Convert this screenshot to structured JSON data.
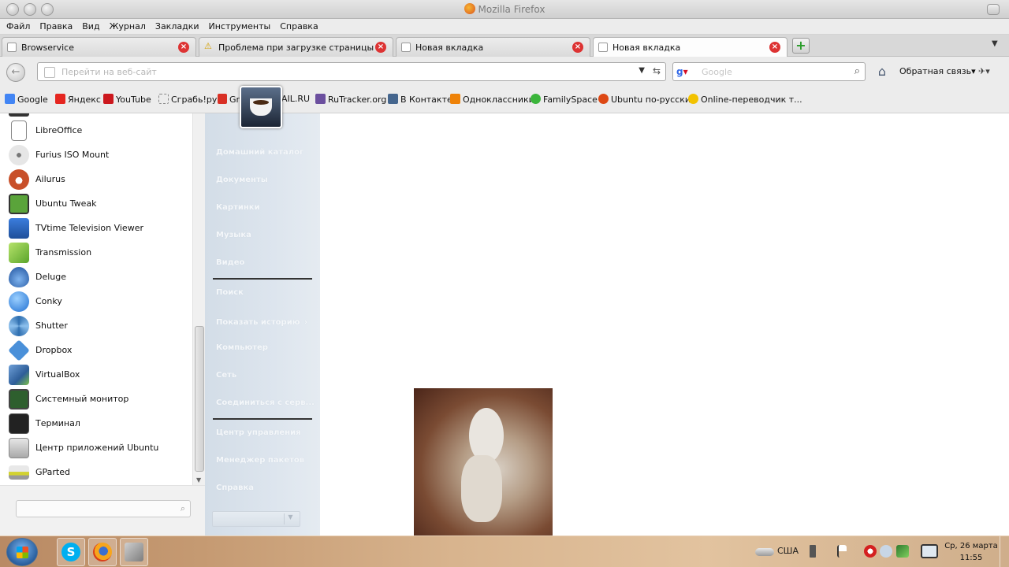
{
  "window": {
    "title": "Mozilla Firefox"
  },
  "menu": [
    "Файл",
    "Правка",
    "Вид",
    "Журнал",
    "Закладки",
    "Инструменты",
    "Справка"
  ],
  "tabs": [
    {
      "label": "Browservice",
      "favicon": "page-icon",
      "active": false
    },
    {
      "label": "Проблема при загрузке страницы",
      "favicon": "warning-icon",
      "active": false
    },
    {
      "label": "Новая вкладка",
      "favicon": "page-icon",
      "active": false
    },
    {
      "label": "Новая вкладка",
      "favicon": "page-icon",
      "active": true
    }
  ],
  "tab_close_glyph": "×",
  "new_tab_glyph": "+",
  "tab_list_glyph": "▼",
  "navbar": {
    "back_glyph": "←",
    "url_placeholder": "Перейти на веб-сайт",
    "url_dropdown_glyph": "▼",
    "go_glyph": "⇆",
    "search_engine": "Google",
    "search_placeholder": "Google",
    "search_glyph": "⌕",
    "home_glyph": "⌂",
    "feedback_label": "Обратная связь▾",
    "ext_glyph": "✈▾"
  },
  "bookmarks": [
    {
      "label": "Google",
      "color": "#4285f4"
    },
    {
      "label": "Яндекс",
      "color": "#e52620"
    },
    {
      "label": "YouTube",
      "color": "#cc181e"
    },
    {
      "label": "Сграбь!ру",
      "color": "#ffffff"
    },
    {
      "label": "Gm",
      "color": "#d93025"
    },
    {
      "label": "AIL.RU",
      "color": "#168de2"
    },
    {
      "label": "RuTracker.org",
      "color": "#6b4f9e"
    },
    {
      "label": "В Контакте",
      "color": "#45668e"
    },
    {
      "label": "Одноклассники",
      "color": "#ee8208"
    },
    {
      "label": "FamilySpace",
      "color": "#3bb53b"
    },
    {
      "label": "Ubuntu по-русски",
      "color": "#dd4814"
    },
    {
      "label": "Online-переводчик т...",
      "color": "#f2c200"
    }
  ],
  "start_menu": {
    "apps": [
      {
        "label": "LibreOffice",
        "icon": "libreoffice-icon",
        "color": "#ffffff"
      },
      {
        "label": "Furius ISO Mount",
        "icon": "disc-icon",
        "color": "#cfcfcf"
      },
      {
        "label": "Ailurus",
        "icon": "red-panda-icon",
        "color": "#c8502a"
      },
      {
        "label": "Ubuntu Tweak",
        "icon": "ubuntu-tweak-icon",
        "color": "#5aa43a"
      },
      {
        "label": "TVtime Television Viewer",
        "icon": "tv-icon",
        "color": "#2f6fc2"
      },
      {
        "label": "Transmission",
        "icon": "transmission-icon",
        "color": "#8ccf3a"
      },
      {
        "label": "Deluge",
        "icon": "deluge-icon",
        "color": "#3d7cc9"
      },
      {
        "label": "Conky",
        "icon": "conky-icon",
        "color": "#2e86de"
      },
      {
        "label": "Shutter",
        "icon": "shutter-icon",
        "color": "#3a78b8"
      },
      {
        "label": "Dropbox",
        "icon": "dropbox-icon",
        "color": "#4a90d9"
      },
      {
        "label": "VirtualBox",
        "icon": "virtualbox-icon",
        "color": "#4d7fb8"
      },
      {
        "label": "Системный монитор",
        "icon": "system-monitor-icon",
        "color": "#2e5f2e"
      },
      {
        "label": "Терминал",
        "icon": "terminal-icon",
        "color": "#222222"
      },
      {
        "label": "Центр приложений Ubuntu",
        "icon": "software-center-icon",
        "color": "#b9b9b9"
      },
      {
        "label": "GParted",
        "icon": "gparted-icon",
        "color": "#d2d230"
      }
    ],
    "search_placeholder": "",
    "search_glyph": "⌕",
    "scroll_down_glyph": "▼",
    "places": [
      "Домашний каталог",
      "Документы",
      "Картинки",
      "Музыка",
      "Видео",
      "Поиск",
      "Показать историю",
      "Компьютер",
      "Сеть",
      "Соединиться с серв...",
      "Центр управления",
      "Менеджер пакетов",
      "Справка"
    ],
    "submenu_glyph": "›",
    "shutdown_arrow_glyph": "▼"
  },
  "taskbar": {
    "apps": [
      {
        "name": "skype-icon",
        "color": "#00aff0",
        "glyph": "S"
      },
      {
        "name": "firefox-icon",
        "color": "#e66000",
        "glyph": ""
      },
      {
        "name": "virtualbox-icon",
        "color": "#8a8a8a",
        "glyph": ""
      }
    ],
    "keyboard_layout": "США",
    "clock_date": "Ср, 26 марта",
    "clock_time": "11:55"
  }
}
